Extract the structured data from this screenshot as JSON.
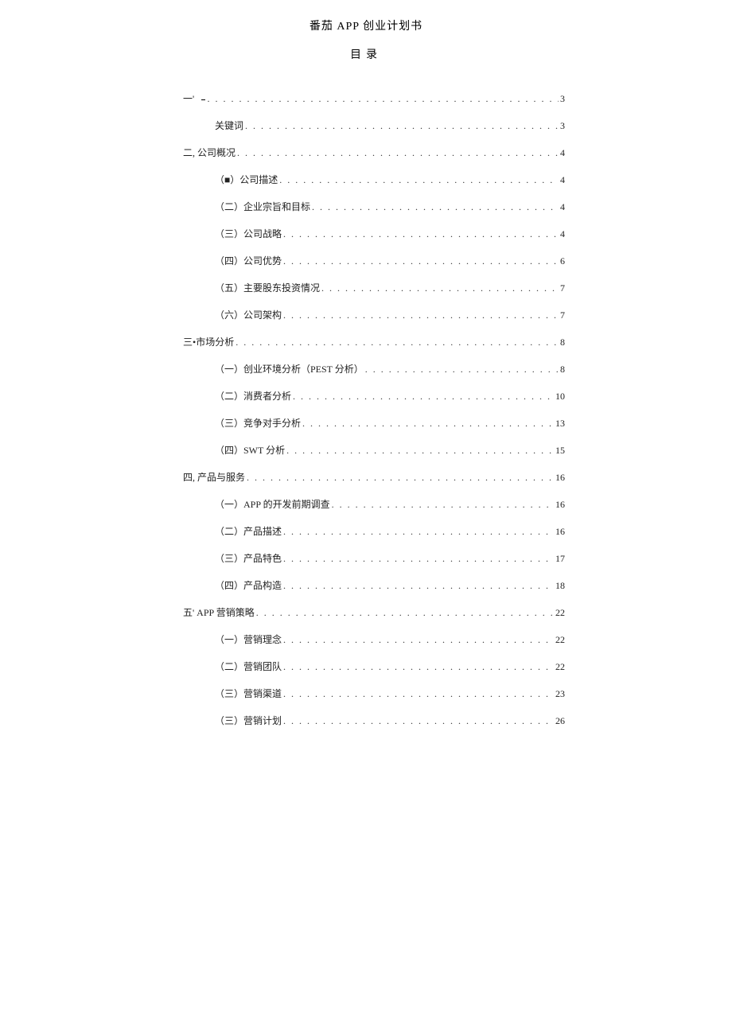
{
  "doc_title": "番茄 APP 创业计划书",
  "toc_title": "目录",
  "entries": [
    {
      "level": 0,
      "label": "一'",
      "underscore": true,
      "page": "3"
    },
    {
      "level": 1,
      "label": "关键词",
      "page": "3"
    },
    {
      "level": 0,
      "label": "二, 公司概况",
      "page": "4"
    },
    {
      "level": 1,
      "label": "（■）公司描述",
      "page": "4"
    },
    {
      "level": 1,
      "label": "（二）企业宗旨和目标",
      "page": "4"
    },
    {
      "level": 1,
      "label": "（三）公司战略",
      "page": "4"
    },
    {
      "level": 1,
      "label": "（四）公司优势",
      "page": "6"
    },
    {
      "level": 1,
      "label": "（五）主要股东投资情况",
      "page": "7"
    },
    {
      "level": 1,
      "label": "（六）公司架构",
      "page": "7"
    },
    {
      "level": 0,
      "label": "三•市场分析",
      "page": "8"
    },
    {
      "level": 1,
      "label": "（一）创业环境分析（PEST 分析）",
      "page": "8"
    },
    {
      "level": 1,
      "label": "（二）消费者分析",
      "page": "10"
    },
    {
      "level": 1,
      "label": "（三）竞争对手分析",
      "page": "13"
    },
    {
      "level": 1,
      "label": "（四）SWT 分析",
      "page": "15"
    },
    {
      "level": 0,
      "label": "四, 产品与服务",
      "page": "16"
    },
    {
      "level": 1,
      "label": "（一）APP 的开发前期调查 ",
      "page": "16"
    },
    {
      "level": 1,
      "label": "（二）产品描述",
      "page": "16"
    },
    {
      "level": 1,
      "label": "（三）产品特色",
      "page": "17"
    },
    {
      "level": 1,
      "label": "（四）产品构造",
      "page": "18"
    },
    {
      "level": 0,
      "label": "五' APP 营销策略",
      "page": "22"
    },
    {
      "level": 1,
      "label": "（一）营销理念",
      "page": "22"
    },
    {
      "level": 1,
      "label": "（二）营销团队",
      "page": "22"
    },
    {
      "level": 1,
      "label": "（三）营销渠道",
      "page": "23"
    },
    {
      "level": 1,
      "label": "（三）营销计划",
      "page": "26"
    }
  ]
}
